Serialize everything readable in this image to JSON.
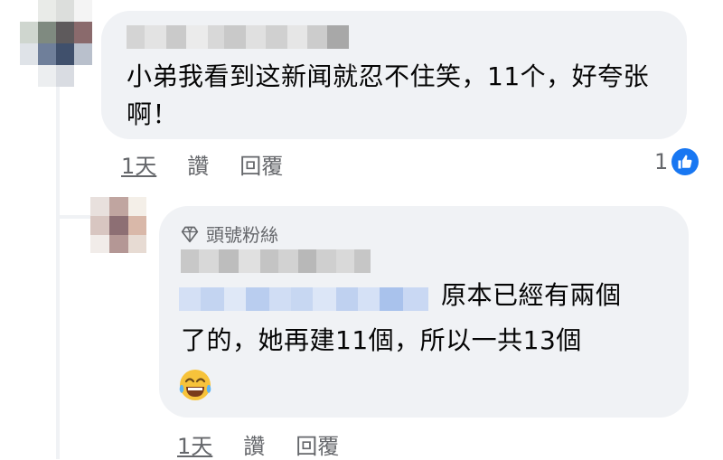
{
  "comments": [
    {
      "text": "小弟我看到这新闻就忍不住笑，11个，好夸张啊！",
      "time": "1天",
      "like_label": "讚",
      "reply_label": "回覆",
      "reaction_count": "1",
      "reaction_icon": "thumbs-up-icon"
    },
    {
      "badge": "頭號粉絲",
      "badge_icon": "diamond-icon",
      "text_line1": "原本已經有兩個",
      "text_line2": "了的，她再建11個，所以一共13個",
      "emoji_icon": "tears-of-joy-icon",
      "time": "1天",
      "like_label": "讚",
      "reply_label": "回覆"
    }
  ],
  "colors": {
    "bubble": "#f0f2f5",
    "meta_text": "#65676b",
    "like_blue": "#1877f2"
  }
}
